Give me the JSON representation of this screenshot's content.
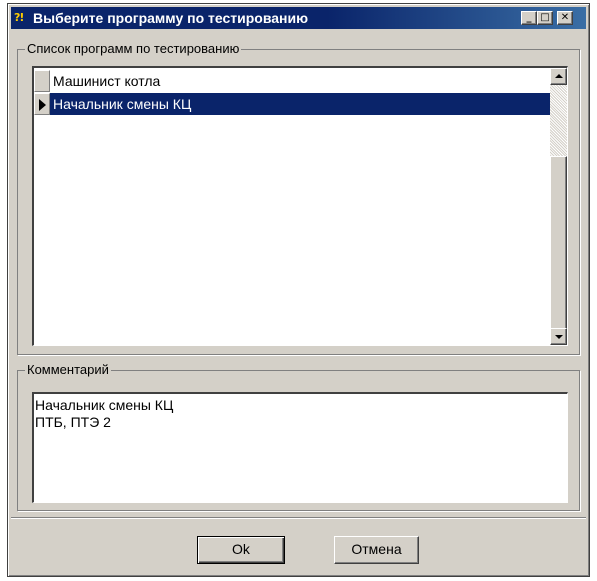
{
  "window": {
    "title": "Выберите программу по тестированию",
    "icon": "question-exclamation-icon",
    "controls": {
      "minimize": "_",
      "maximize": "□",
      "close": "✕"
    }
  },
  "programs": {
    "legend": "Список программ по тестированию",
    "items": [
      {
        "label": "Машинист котла",
        "selected": false
      },
      {
        "label": "Начальник смены КЦ",
        "selected": true
      }
    ]
  },
  "comment": {
    "legend": "Комментарий",
    "lines": [
      "Начальник смены КЦ",
      "ПТБ, ПТЭ 2"
    ]
  },
  "buttons": {
    "ok": "Ok",
    "cancel": "Отмена"
  },
  "colors": {
    "selection": "#0a246a",
    "face": "#d4d0c8",
    "titlebar": "#0a246a"
  }
}
